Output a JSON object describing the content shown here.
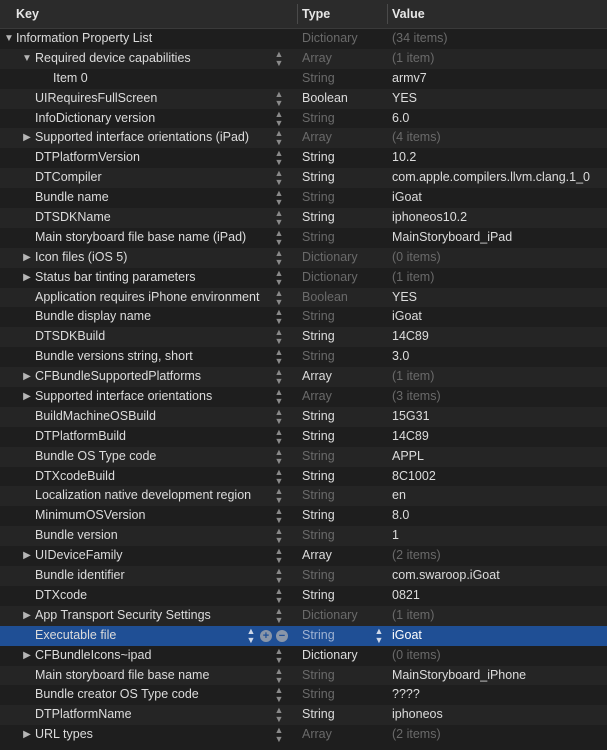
{
  "header": {
    "key": "Key",
    "type": "Type",
    "value": "Value"
  },
  "rows": [
    {
      "key": "Information Property List",
      "type": "Dictionary",
      "value": "(34 items)"
    },
    {
      "key": "Required device capabilities",
      "type": "Array",
      "value": "(1 item)"
    },
    {
      "key": "Item 0",
      "type": "String",
      "value": "armv7"
    },
    {
      "key": "UIRequiresFullScreen",
      "type": "Boolean",
      "value": "YES"
    },
    {
      "key": "InfoDictionary version",
      "type": "String",
      "value": "6.0"
    },
    {
      "key": "Supported interface orientations (iPad)",
      "type": "Array",
      "value": "(4 items)"
    },
    {
      "key": "DTPlatformVersion",
      "type": "String",
      "value": "10.2"
    },
    {
      "key": "DTCompiler",
      "type": "String",
      "value": "com.apple.compilers.llvm.clang.1_0"
    },
    {
      "key": "Bundle name",
      "type": "String",
      "value": "iGoat"
    },
    {
      "key": "DTSDKName",
      "type": "String",
      "value": "iphoneos10.2"
    },
    {
      "key": "Main storyboard file base name (iPad)",
      "type": "String",
      "value": "MainStoryboard_iPad"
    },
    {
      "key": "Icon files (iOS 5)",
      "type": "Dictionary",
      "value": "(0 items)"
    },
    {
      "key": "Status bar tinting parameters",
      "type": "Dictionary",
      "value": "(1 item)"
    },
    {
      "key": "Application requires iPhone environment",
      "type": "Boolean",
      "value": "YES"
    },
    {
      "key": "Bundle display name",
      "type": "String",
      "value": "iGoat"
    },
    {
      "key": "DTSDKBuild",
      "type": "String",
      "value": "14C89"
    },
    {
      "key": "Bundle versions string, short",
      "type": "String",
      "value": "3.0"
    },
    {
      "key": "CFBundleSupportedPlatforms",
      "type": "Array",
      "value": "(1 item)"
    },
    {
      "key": "Supported interface orientations",
      "type": "Array",
      "value": "(3 items)"
    },
    {
      "key": "BuildMachineOSBuild",
      "type": "String",
      "value": "15G31"
    },
    {
      "key": "DTPlatformBuild",
      "type": "String",
      "value": "14C89"
    },
    {
      "key": "Bundle OS Type code",
      "type": "String",
      "value": "APPL"
    },
    {
      "key": "DTXcodeBuild",
      "type": "String",
      "value": "8C1002"
    },
    {
      "key": "Localization native development region",
      "type": "String",
      "value": "en"
    },
    {
      "key": "MinimumOSVersion",
      "type": "String",
      "value": "8.0"
    },
    {
      "key": "Bundle version",
      "type": "String",
      "value": "1"
    },
    {
      "key": "UIDeviceFamily",
      "type": "Array",
      "value": "(2 items)"
    },
    {
      "key": "Bundle identifier",
      "type": "String",
      "value": "com.swaroop.iGoat"
    },
    {
      "key": "DTXcode",
      "type": "String",
      "value": "0821"
    },
    {
      "key": "App Transport Security Settings",
      "type": "Dictionary",
      "value": "(1 item)"
    },
    {
      "key": "Executable file",
      "type": "String",
      "value": "iGoat"
    },
    {
      "key": "CFBundleIcons~ipad",
      "type": "Dictionary",
      "value": "(0 items)"
    },
    {
      "key": "Main storyboard file base name",
      "type": "String",
      "value": "MainStoryboard_iPhone"
    },
    {
      "key": "Bundle creator OS Type code",
      "type": "String",
      "value": "????"
    },
    {
      "key": "DTPlatformName",
      "type": "String",
      "value": "iphoneos"
    },
    {
      "key": "URL types",
      "type": "Array",
      "value": "(2 items)"
    }
  ]
}
